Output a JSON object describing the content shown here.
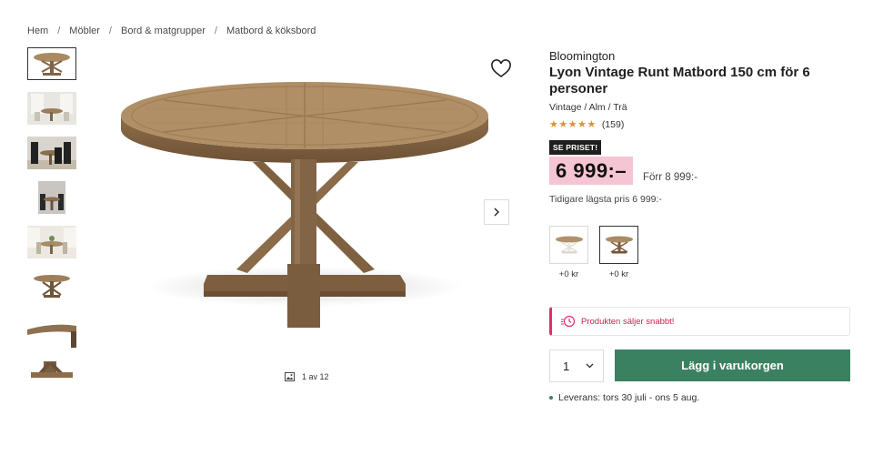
{
  "breadcrumb": {
    "items": [
      "Hem",
      "Möbler",
      "Bord & matgrupper",
      "Matbord & köksbord"
    ],
    "separator": "/"
  },
  "gallery": {
    "counter": "1 av 12",
    "thumbnails": [
      "table-top-view",
      "table-room-light",
      "table-with-black-chairs",
      "table-dining-room",
      "table-kitchen-scene",
      "table-angle-view",
      "table-closeup-edge",
      "table-closeup-base"
    ]
  },
  "product": {
    "brand": "Bloomington",
    "title": "Lyon Vintage Runt Matbord 150 cm för 6 personer",
    "subtitle": "Vintage / Alm / Trä",
    "rating": {
      "stars": "★★★★★",
      "value": 4.6,
      "count": "(159)"
    },
    "badge": "SE PRISET!",
    "price": "6 999:–",
    "old_price": "Förr 8 999:-",
    "previous_lowest": "Tidigare lägsta pris 6 999:-"
  },
  "variants": [
    {
      "name": "white-base",
      "price": "+0 kr",
      "selected": false
    },
    {
      "name": "wood-base",
      "price": "+0 kr",
      "selected": true
    }
  ],
  "alert": {
    "text": "Produkten säljer snabbt!"
  },
  "purchase": {
    "quantity": "1",
    "add_to_cart": "Lägg i varukorgen",
    "delivery": "Leverans: tors 30 juli - ons 5 aug."
  },
  "colors": {
    "accent_green": "#3a8161",
    "price_highlight": "#f6c5d3",
    "alert_red": "#d8346a",
    "star": "#e0932b",
    "wood": "#a98a63"
  }
}
